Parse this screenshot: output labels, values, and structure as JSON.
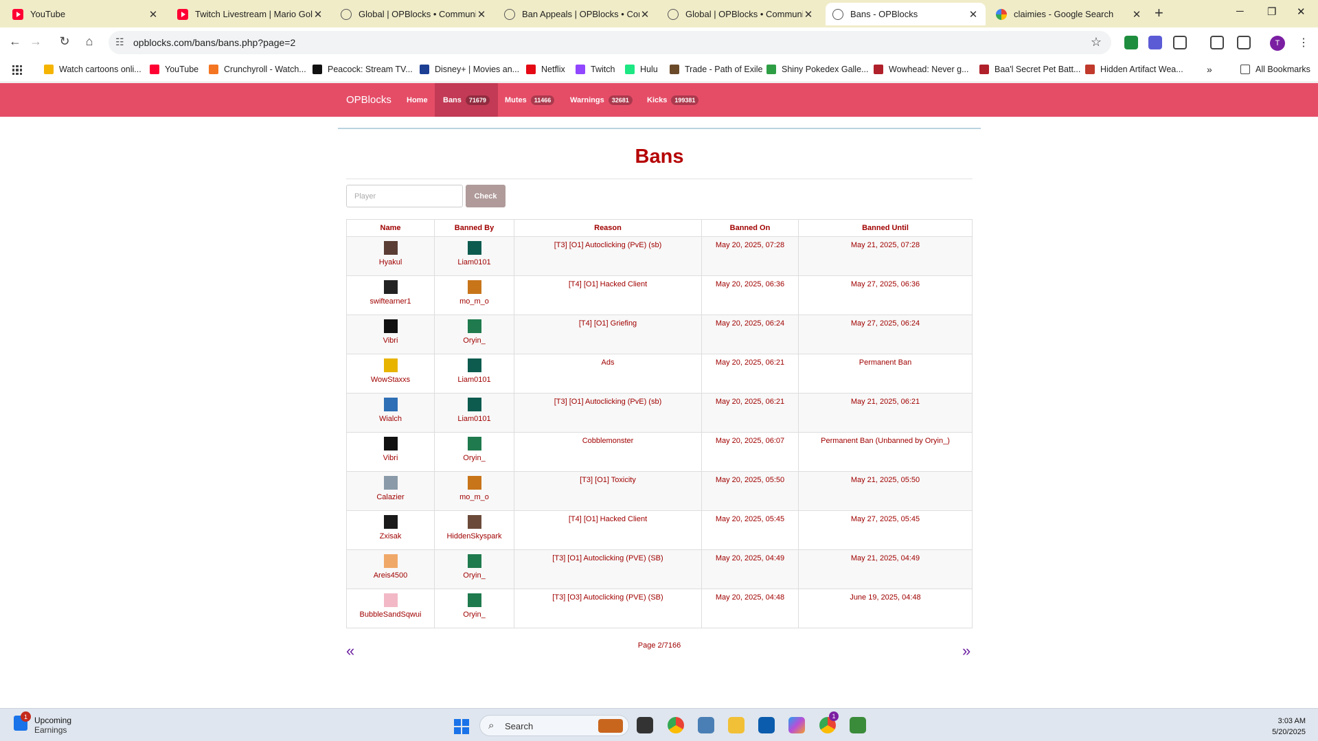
{
  "browser": {
    "tabs": [
      {
        "title": "YouTube",
        "icon": "youtube-icon",
        "active": false
      },
      {
        "title": "Twitch Livestream | Mario Golf:",
        "icon": "youtube-icon",
        "active": false
      },
      {
        "title": "Global | OPBlocks • Community",
        "icon": "globe-icon",
        "active": false
      },
      {
        "title": "Ban Appeals | OPBlocks • Comm",
        "icon": "globe-icon",
        "active": false
      },
      {
        "title": "Global | OPBlocks • Community",
        "icon": "globe-icon",
        "active": false
      },
      {
        "title": "Bans - OPBlocks",
        "icon": "globe-icon",
        "active": true
      },
      {
        "title": "claimies - Google Search",
        "icon": "google-icon",
        "active": false
      }
    ],
    "url": "opblocks.com/bans/bans.php?page=2",
    "bookmarks": [
      {
        "label": "Watch cartoons onli...",
        "color": "#f5b400"
      },
      {
        "label": "YouTube",
        "color": "#ff0033"
      },
      {
        "label": "Crunchyroll - Watch...",
        "color": "#f47521"
      },
      {
        "label": "Peacock: Stream TV...",
        "color": "#111111"
      },
      {
        "label": "Disney+ | Movies an...",
        "color": "#1c3f94"
      },
      {
        "label": "Netflix",
        "color": "#e50914"
      },
      {
        "label": "Twitch",
        "color": "#9146ff"
      },
      {
        "label": "Hulu",
        "color": "#1ce783"
      },
      {
        "label": "Trade - Path of Exile",
        "color": "#6b4a2a"
      },
      {
        "label": "Shiny Pokedex Galle...",
        "color": "#2e9e44"
      },
      {
        "label": "Wowhead: Never g...",
        "color": "#b0202a"
      },
      {
        "label": "Baa'l Secret Pet Batt...",
        "color": "#b0202a"
      },
      {
        "label": "Hidden Artifact Wea...",
        "color": "#c0392b"
      }
    ],
    "all_bookmarks": "All Bookmarks",
    "avatar_letter": "T"
  },
  "site": {
    "brand": "OPBlocks",
    "nav": [
      {
        "label": "Home",
        "count": "",
        "active": false
      },
      {
        "label": "Bans",
        "count": "71679",
        "active": true
      },
      {
        "label": "Mutes",
        "count": "11466",
        "active": false
      },
      {
        "label": "Warnings",
        "count": "32681",
        "active": false
      },
      {
        "label": "Kicks",
        "count": "199381",
        "active": false
      }
    ],
    "colors": {
      "navbar": "#e54d67",
      "text": "#a00000",
      "title": "#b50000"
    }
  },
  "page": {
    "title": "Bans",
    "search_placeholder": "Player",
    "check_label": "Check",
    "columns": [
      "Name",
      "Banned By",
      "Reason",
      "Banned On",
      "Banned Until"
    ],
    "rows": [
      {
        "name": "Hyakul",
        "by": "Liam0101",
        "reason": "[T3] [O1] Autoclicking (PvE) (sb)",
        "on": "May 20, 2025, 07:28",
        "until": "May 21, 2025, 07:28"
      },
      {
        "name": "swiftearner1",
        "by": "mo_m_o",
        "reason": "[T4] [O1] Hacked Client",
        "on": "May 20, 2025, 06:36",
        "until": "May 27, 2025, 06:36"
      },
      {
        "name": "Vibri",
        "by": "Oryin_",
        "reason": "[T4] [O1] Griefing",
        "on": "May 20, 2025, 06:24",
        "until": "May 27, 2025, 06:24"
      },
      {
        "name": "WowStaxxs",
        "by": "Liam0101",
        "reason": "Ads",
        "on": "May 20, 2025, 06:21",
        "until": "Permanent Ban"
      },
      {
        "name": "Wialch",
        "by": "Liam0101",
        "reason": "[T3] [O1] Autoclicking (PvE) (sb)",
        "on": "May 20, 2025, 06:21",
        "until": "May 21, 2025, 06:21"
      },
      {
        "name": "Vibri",
        "by": "Oryin_",
        "reason": "Cobblemonster",
        "on": "May 20, 2025, 06:07",
        "until": "Permanent Ban (Unbanned by Oryin_)"
      },
      {
        "name": "Calazier",
        "by": "mo_m_o",
        "reason": "[T3] [O1] Toxicity",
        "on": "May 20, 2025, 05:50",
        "until": "May 21, 2025, 05:50"
      },
      {
        "name": "Zxisak",
        "by": "HiddenSkyspark",
        "reason": "[T4] [O1] Hacked Client",
        "on": "May 20, 2025, 05:45",
        "until": "May 27, 2025, 05:45"
      },
      {
        "name": "Areis4500",
        "by": "Oryin_",
        "reason": "[T3] [O1] Autoclicking (PVE) (SB)",
        "on": "May 20, 2025, 04:49",
        "until": "May 21, 2025, 04:49"
      },
      {
        "name": "BubbleSandSqwui",
        "by": "Oryin_",
        "reason": "[T3] [O3] Autoclicking (PVE) (SB)",
        "on": "May 20, 2025, 04:48",
        "until": "June 19, 2025, 04:48"
      }
    ],
    "head_colors": {
      "Hyakul": "#5a3d35",
      "swiftearner1": "#222222",
      "Vibri": "#111111",
      "WowStaxxs": "#e8b400",
      "Wialch": "#2f6fb5",
      "Calazier": "#8a9aa8",
      "Zxisak": "#1a1a1a",
      "Areis4500": "#f0a868",
      "BubbleSandSqwui": "#f2b8c6",
      "Liam0101": "#0d5b4f",
      "mo_m_o": "#c8751a",
      "Oryin_": "#1f7a4d",
      "HiddenSkyspark": "#6b4a3a"
    },
    "pagination": {
      "prev": "«",
      "next": "»",
      "info": "Page 2/7166"
    }
  },
  "taskbar": {
    "widget_badge": "1",
    "widget_line1": "Upcoming",
    "widget_line2": "Earnings",
    "search": "Search",
    "time": "3:03 AM",
    "date": "5/20/2025",
    "chrome_badge": "1"
  }
}
